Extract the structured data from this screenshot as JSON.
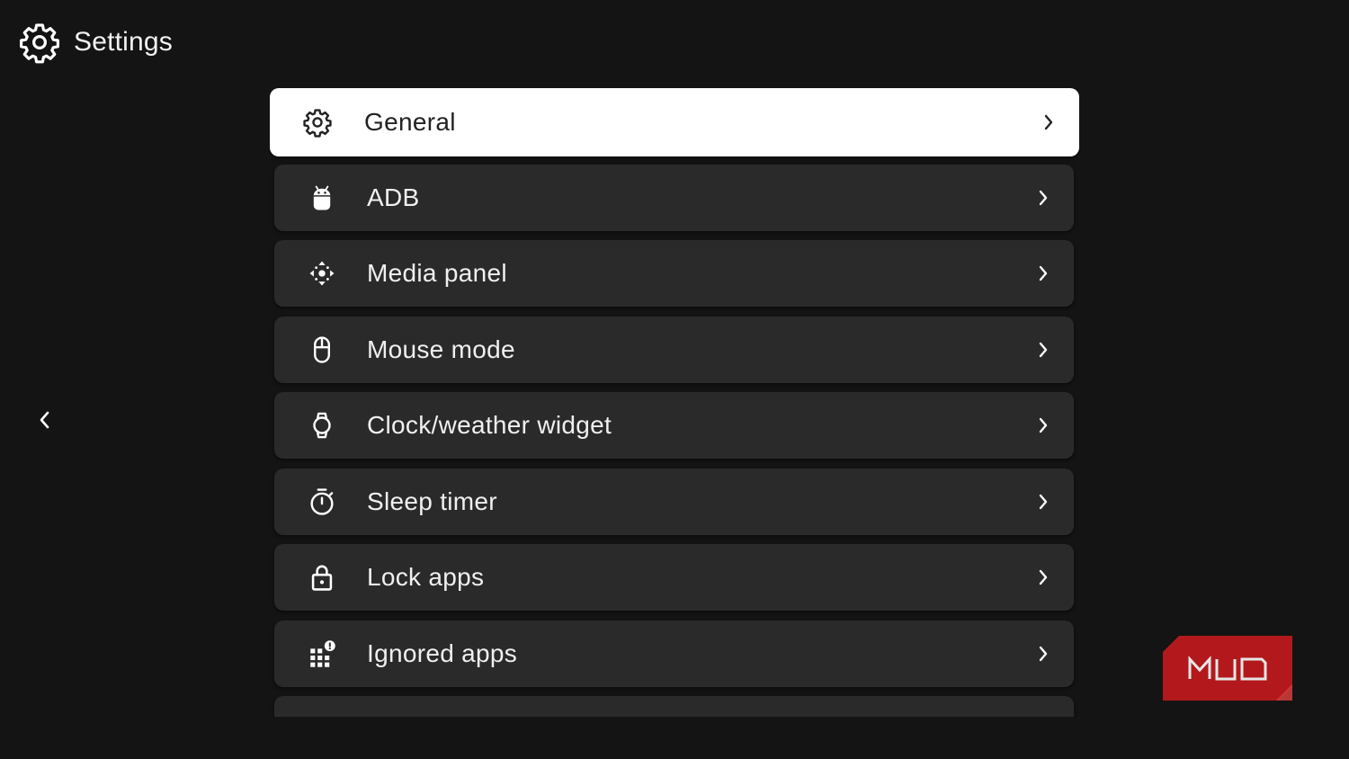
{
  "header": {
    "title": "Settings",
    "icon": "gear-icon"
  },
  "back": {
    "icon": "chevron-left-icon"
  },
  "menu": {
    "items": [
      {
        "label": "General",
        "icon": "gear-icon",
        "selected": true
      },
      {
        "label": "ADB",
        "icon": "android-icon"
      },
      {
        "label": "Media panel",
        "icon": "dpad-icon"
      },
      {
        "label": "Mouse mode",
        "icon": "mouse-icon"
      },
      {
        "label": "Clock/weather widget",
        "icon": "watch-icon"
      },
      {
        "label": "Sleep timer",
        "icon": "timer-icon"
      },
      {
        "label": "Lock apps",
        "icon": "lock-icon"
      },
      {
        "label": "Ignored apps",
        "icon": "apps-grid-alert-icon"
      },
      {
        "label": "",
        "icon": "partial-item-icon"
      }
    ]
  },
  "colors": {
    "background": "#141414",
    "card": "#2a2a2a",
    "selected_card": "#ffffff",
    "text": "#f0f0f0",
    "selected_text": "#222222"
  },
  "watermark": {
    "text": "MUO",
    "color": "#b3191c"
  }
}
